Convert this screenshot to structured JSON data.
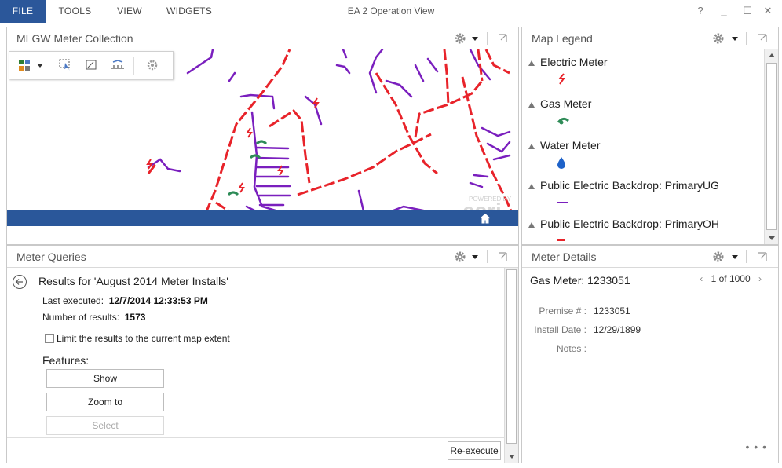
{
  "window": {
    "title": "EA 2 Operation View",
    "menu": [
      "FILE",
      "TOOLS",
      "VIEW",
      "WIDGETS"
    ],
    "controls": {
      "help": "?",
      "minimize": "_",
      "maximize": "☐",
      "close": "✕"
    }
  },
  "icons": {
    "gear": "gear-icon",
    "caret": "chevron-down-icon",
    "popout": "popout-icon",
    "home": "home-icon",
    "back": "back-arrow-icon"
  },
  "colors": {
    "accent": "#2b579a",
    "electric": "#e8232a",
    "purple": "#7a1fbe",
    "gas": "#2e8b57",
    "water": "#1e62c9"
  },
  "map_panel": {
    "title": "MLGW Meter Collection",
    "watermark_small": "POWERED BY",
    "watermark_logo": "esri"
  },
  "legend_panel": {
    "title": "Map Legend",
    "items": [
      {
        "label": "Electric Meter",
        "symbol": "electric-meter-icon"
      },
      {
        "label": "Gas Meter",
        "symbol": "gas-meter-icon"
      },
      {
        "label": "Water Meter",
        "symbol": "water-meter-icon"
      },
      {
        "label": "Public Electric Backdrop: PrimaryUG",
        "symbol": "purple-line"
      },
      {
        "label": "Public Electric Backdrop: PrimaryOH",
        "symbol": "red-dashed-line"
      }
    ]
  },
  "queries_panel": {
    "title": "Meter Queries",
    "results_title": "Results for 'August 2014 Meter Installs'",
    "last_executed_label": "Last executed:",
    "last_executed_value": "12/7/2014 12:33:53 PM",
    "num_results_label": "Number of results:",
    "num_results_value": "1573",
    "limit_checkbox_label": "Limit the results to the current map extent",
    "features_label": "Features:",
    "buttons": {
      "show": "Show",
      "zoom": "Zoom to",
      "select": "Select"
    },
    "reexecute": "Re-execute"
  },
  "details_panel": {
    "title": "Meter Details",
    "record_title": "Gas Meter: 1233051",
    "pager": {
      "prev": "‹",
      "text": "1 of 1000",
      "next": "›"
    },
    "fields": [
      {
        "key": "Premise # :",
        "value": "1233051"
      },
      {
        "key": "Install Date :",
        "value": "12/29/1899"
      },
      {
        "key": "Notes :",
        "value": ""
      }
    ],
    "more": "• • •"
  }
}
